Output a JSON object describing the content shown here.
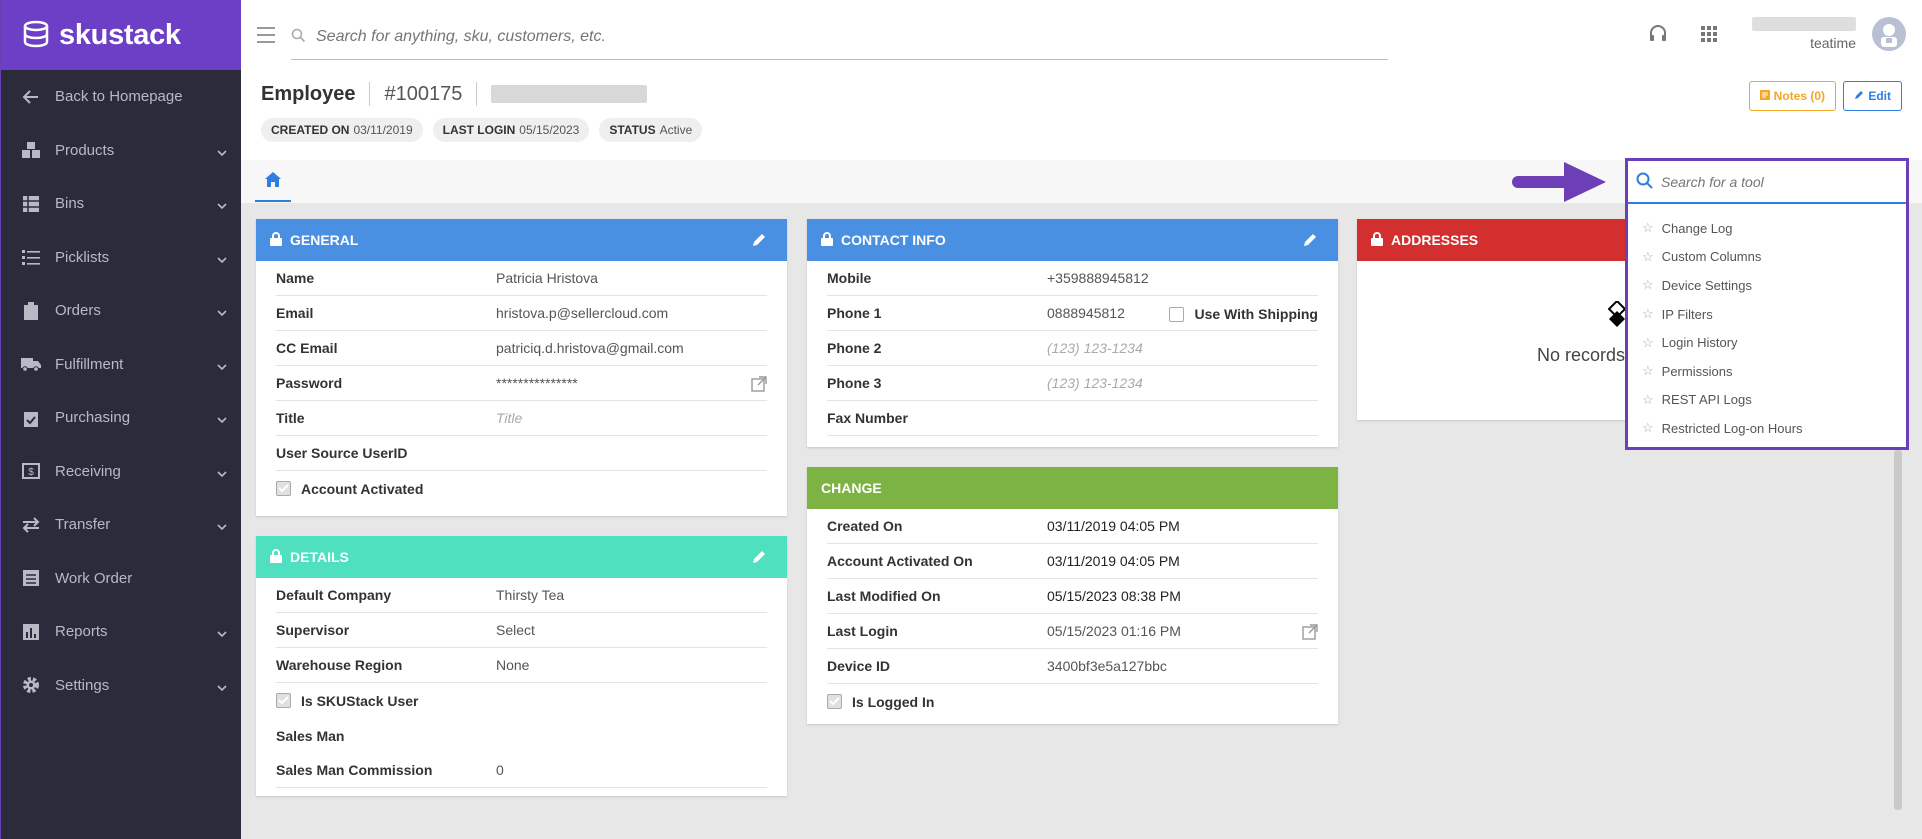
{
  "brand": {
    "name": "skustack"
  },
  "sidebar": {
    "items": [
      {
        "label": "Back to Homepage",
        "icon": "arrow-left-icon",
        "chevron": false
      },
      {
        "label": "Products",
        "icon": "boxes-icon",
        "chevron": true
      },
      {
        "label": "Bins",
        "icon": "bins-icon",
        "chevron": true
      },
      {
        "label": "Picklists",
        "icon": "list-icon",
        "chevron": true
      },
      {
        "label": "Orders",
        "icon": "clipboard-icon",
        "chevron": true
      },
      {
        "label": "Fulfillment",
        "icon": "truck-icon",
        "chevron": true
      },
      {
        "label": "Purchasing",
        "icon": "clipboard-check-icon",
        "chevron": true
      },
      {
        "label": "Receiving",
        "icon": "receiving-icon",
        "chevron": true
      },
      {
        "label": "Transfer",
        "icon": "transfer-icon",
        "chevron": true
      },
      {
        "label": "Work Order",
        "icon": "work-order-icon",
        "chevron": false
      },
      {
        "label": "Reports",
        "icon": "reports-icon",
        "chevron": true
      },
      {
        "label": "Settings",
        "icon": "gear-icon",
        "chevron": true
      }
    ]
  },
  "topbar": {
    "search_placeholder": "Search for anything, sku, customers, etc.",
    "company": "teatime"
  },
  "header": {
    "entity": "Employee",
    "id": "#100175",
    "chips": {
      "created_label": "CREATED ON",
      "created_value": "03/11/2019",
      "login_label": "LAST LOGIN",
      "login_value": "05/15/2023",
      "status_label": "STATUS",
      "status_value": "Active"
    },
    "notes_label": "Notes (0)",
    "edit_label": "Edit"
  },
  "general": {
    "title": "GENERAL",
    "rows": [
      {
        "label": "Name",
        "value": "Patricia Hristova"
      },
      {
        "label": "Email",
        "value": "hristova.p@sellercloud.com"
      },
      {
        "label": "CC Email",
        "value": "patriciq.d.hristova@gmail.com"
      },
      {
        "label": "Password",
        "value": "***************"
      },
      {
        "label": "Title",
        "placeholder": "Title"
      },
      {
        "label": "User Source UserID",
        "value": ""
      }
    ],
    "account_activated": "Account Activated"
  },
  "details": {
    "title": "DETAILS",
    "rows": [
      {
        "label": "Default Company",
        "value": "Thirsty Tea"
      },
      {
        "label": "Supervisor",
        "value": "Select"
      },
      {
        "label": "Warehouse Region",
        "value": "None"
      }
    ],
    "is_skustack_user": "Is SKUStack User",
    "sales_man": "Sales Man",
    "commission_label": "Sales Man Commission",
    "commission_value": "0"
  },
  "contact": {
    "title": "CONTACT INFO",
    "mobile_label": "Mobile",
    "mobile_value": "+359888945812",
    "phone1_label": "Phone 1",
    "phone1_value": "0888945812",
    "use_with_shipping": "Use With Shipping",
    "phone2_label": "Phone 2",
    "phone2_placeholder": "(123) 123-1234",
    "phone3_label": "Phone 3",
    "phone3_placeholder": "(123) 123-1234",
    "fax_label": "Fax Number"
  },
  "change": {
    "title": "CHANGE",
    "rows": [
      {
        "label": "Created On",
        "value": "03/11/2019 04:05 PM"
      },
      {
        "label": "Account Activated On",
        "value": "03/11/2019 04:05 PM"
      },
      {
        "label": "Last Modified On",
        "value": "05/15/2023 08:38 PM"
      },
      {
        "label": "Last Login",
        "value": "05/15/2023 01:16 PM"
      },
      {
        "label": "Device ID",
        "value": "3400bf3e5a127bbc"
      }
    ],
    "is_logged_in": "Is Logged In"
  },
  "addresses": {
    "title": "ADDRESSES",
    "empty_text": "No records"
  },
  "tools": {
    "placeholder": "Search for a tool",
    "items": [
      "Change Log",
      "Custom Columns",
      "Device Settings",
      "IP Filters",
      "Login History",
      "Permissions",
      "REST API Logs",
      "Restricted Log-on Hours"
    ]
  },
  "colors": {
    "brand": "#6c3fc6",
    "sidebar": "#2b2b3b",
    "general_header": "#4a90e2",
    "details_header": "#4fe0c0",
    "change_header": "#7cb342",
    "addresses_header": "#d32f2f",
    "highlight": "#6c3fb6"
  }
}
